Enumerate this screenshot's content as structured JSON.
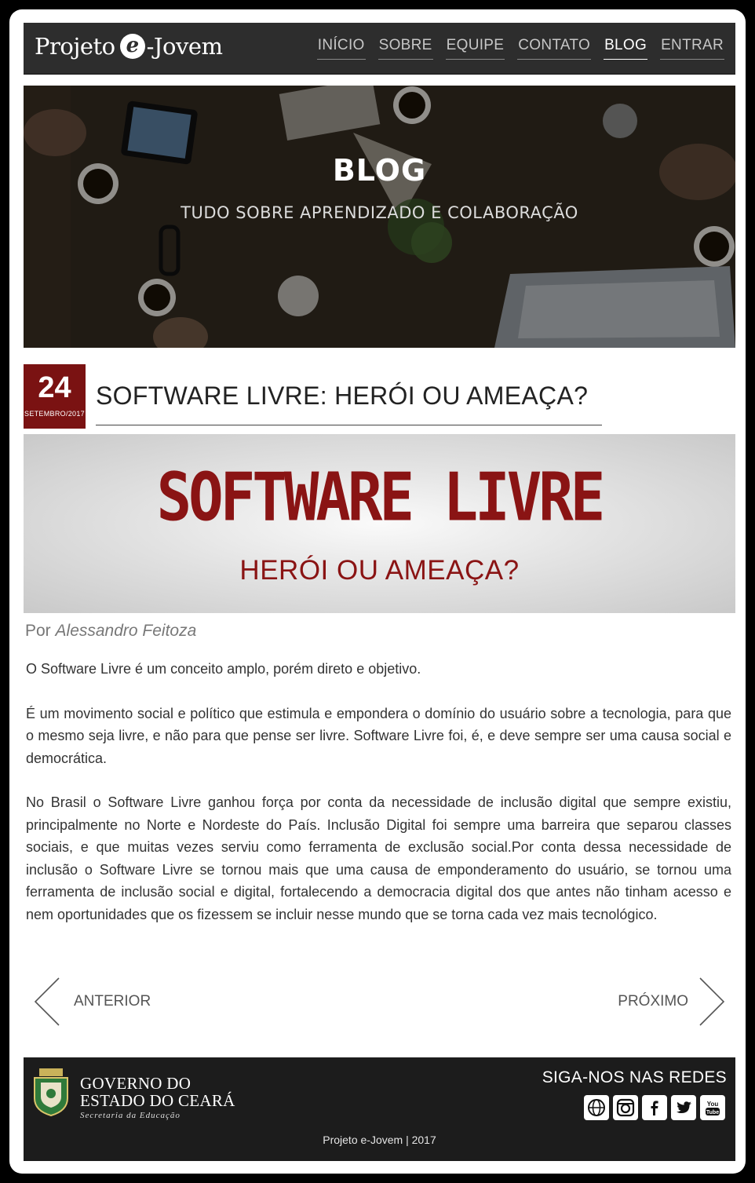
{
  "header": {
    "logo_left": "Projeto",
    "logo_mark": "e",
    "logo_right": "-Jovem",
    "nav": [
      {
        "label": "INÍCIO"
      },
      {
        "label": "SOBRE"
      },
      {
        "label": "EQUIPE"
      },
      {
        "label": "CONTATO"
      },
      {
        "label": "BLOG"
      },
      {
        "label": "ENTRAR"
      }
    ],
    "active_nav": "BLOG"
  },
  "hero": {
    "title": "BLOG",
    "subtitle": "TUDO SOBRE APRENDIZADO E COLABORAÇÃO"
  },
  "post": {
    "day": "24",
    "month_year": "SETEMBRO/2017",
    "title": "SOFTWARE LIVRE: HERÓI OU AMEAÇA?",
    "banner_title": "SOFTWARE LIVRE",
    "banner_subtitle": "HERÓI OU AMEAÇA?",
    "byline_prefix": "Por",
    "author": "Alessandro Feitoza",
    "paragraphs": [
      "O Software Livre é um conceito amplo, porém direto e objetivo.",
      "É um movimento social e político que estimula e empondera o domínio do usuário sobre a tecnologia, para que o mesmo seja livre, e não para que pense ser livre. Software Livre foi, é, e deve sempre ser uma causa social e democrática.",
      "No Brasil o Software Livre ganhou força por conta da necessidade de inclusão digital que sempre existiu, principalmente no Norte e Nordeste do País. Inclusão Digital foi sempre uma barreira que separou classes sociais, e que muitas vezes serviu como ferramenta de exclusão social.Por conta dessa necessidade de inclusão o Software Livre se tornou mais que uma causa de emponderamento do usuário, se tornou uma ferramenta de inclusão social e digital, fortalecendo a democracia digital dos que antes não tinham acesso e nem oportunidades que os fizessem se incluir nesse mundo que se torna cada vez mais tecnológico."
    ]
  },
  "pager": {
    "prev_label": "ANTERIOR",
    "next_label": "PRÓXIMO"
  },
  "footer": {
    "gov_line1": "GOVERNO DO",
    "gov_line2": "ESTADO DO CEARÁ",
    "gov_line3": "Secretaria da Educação",
    "follow_label": "SIGA-NOS NAS REDES",
    "social_icons": [
      "www-icon",
      "instagram-icon",
      "facebook-icon",
      "twitter-icon",
      "youtube-icon"
    ],
    "copyright": "Projeto e-Jovem | 2017"
  },
  "colors": {
    "header_bg": "#2d2d2d",
    "accent_red": "#7a1212",
    "footer_bg": "#1c1c1c"
  }
}
